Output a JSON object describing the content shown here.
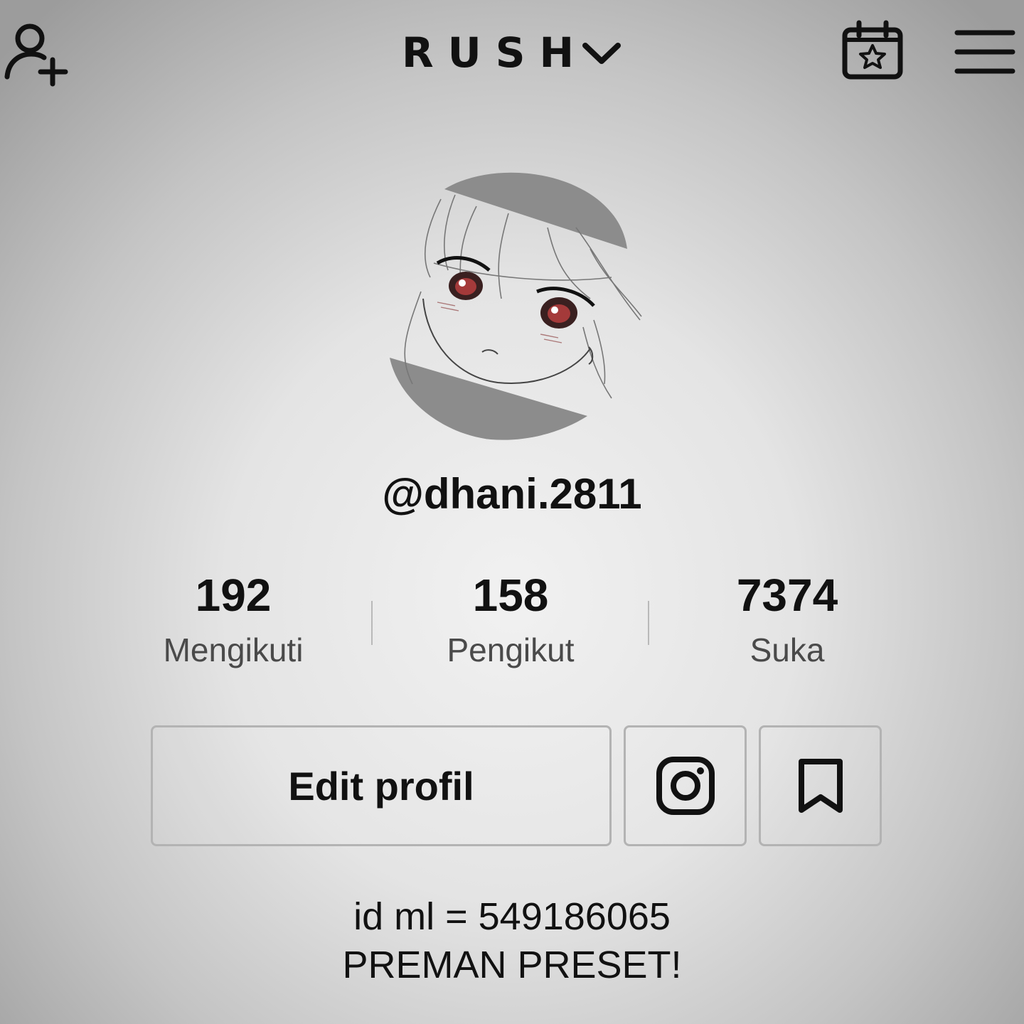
{
  "header": {
    "account_name": "RUSH",
    "icons": {
      "left": "add-friend-icon",
      "title_dropdown": "chevron-down-icon",
      "calendar": "calendar-star-icon",
      "menu": "hamburger-menu-icon"
    }
  },
  "profile": {
    "username": "@dhani.2811",
    "avatar": "avatar"
  },
  "stats": [
    {
      "value": "192",
      "label": "Mengikuti"
    },
    {
      "value": "158",
      "label": "Pengikut"
    },
    {
      "value": "7374",
      "label": "Suka"
    }
  ],
  "actions": {
    "edit_label": "Edit profil",
    "instagram_icon": "instagram-icon",
    "bookmark_icon": "bookmark-icon"
  },
  "bio": {
    "line1": "id ml = 549186065",
    "line2": "PREMAN PRESET!"
  }
}
